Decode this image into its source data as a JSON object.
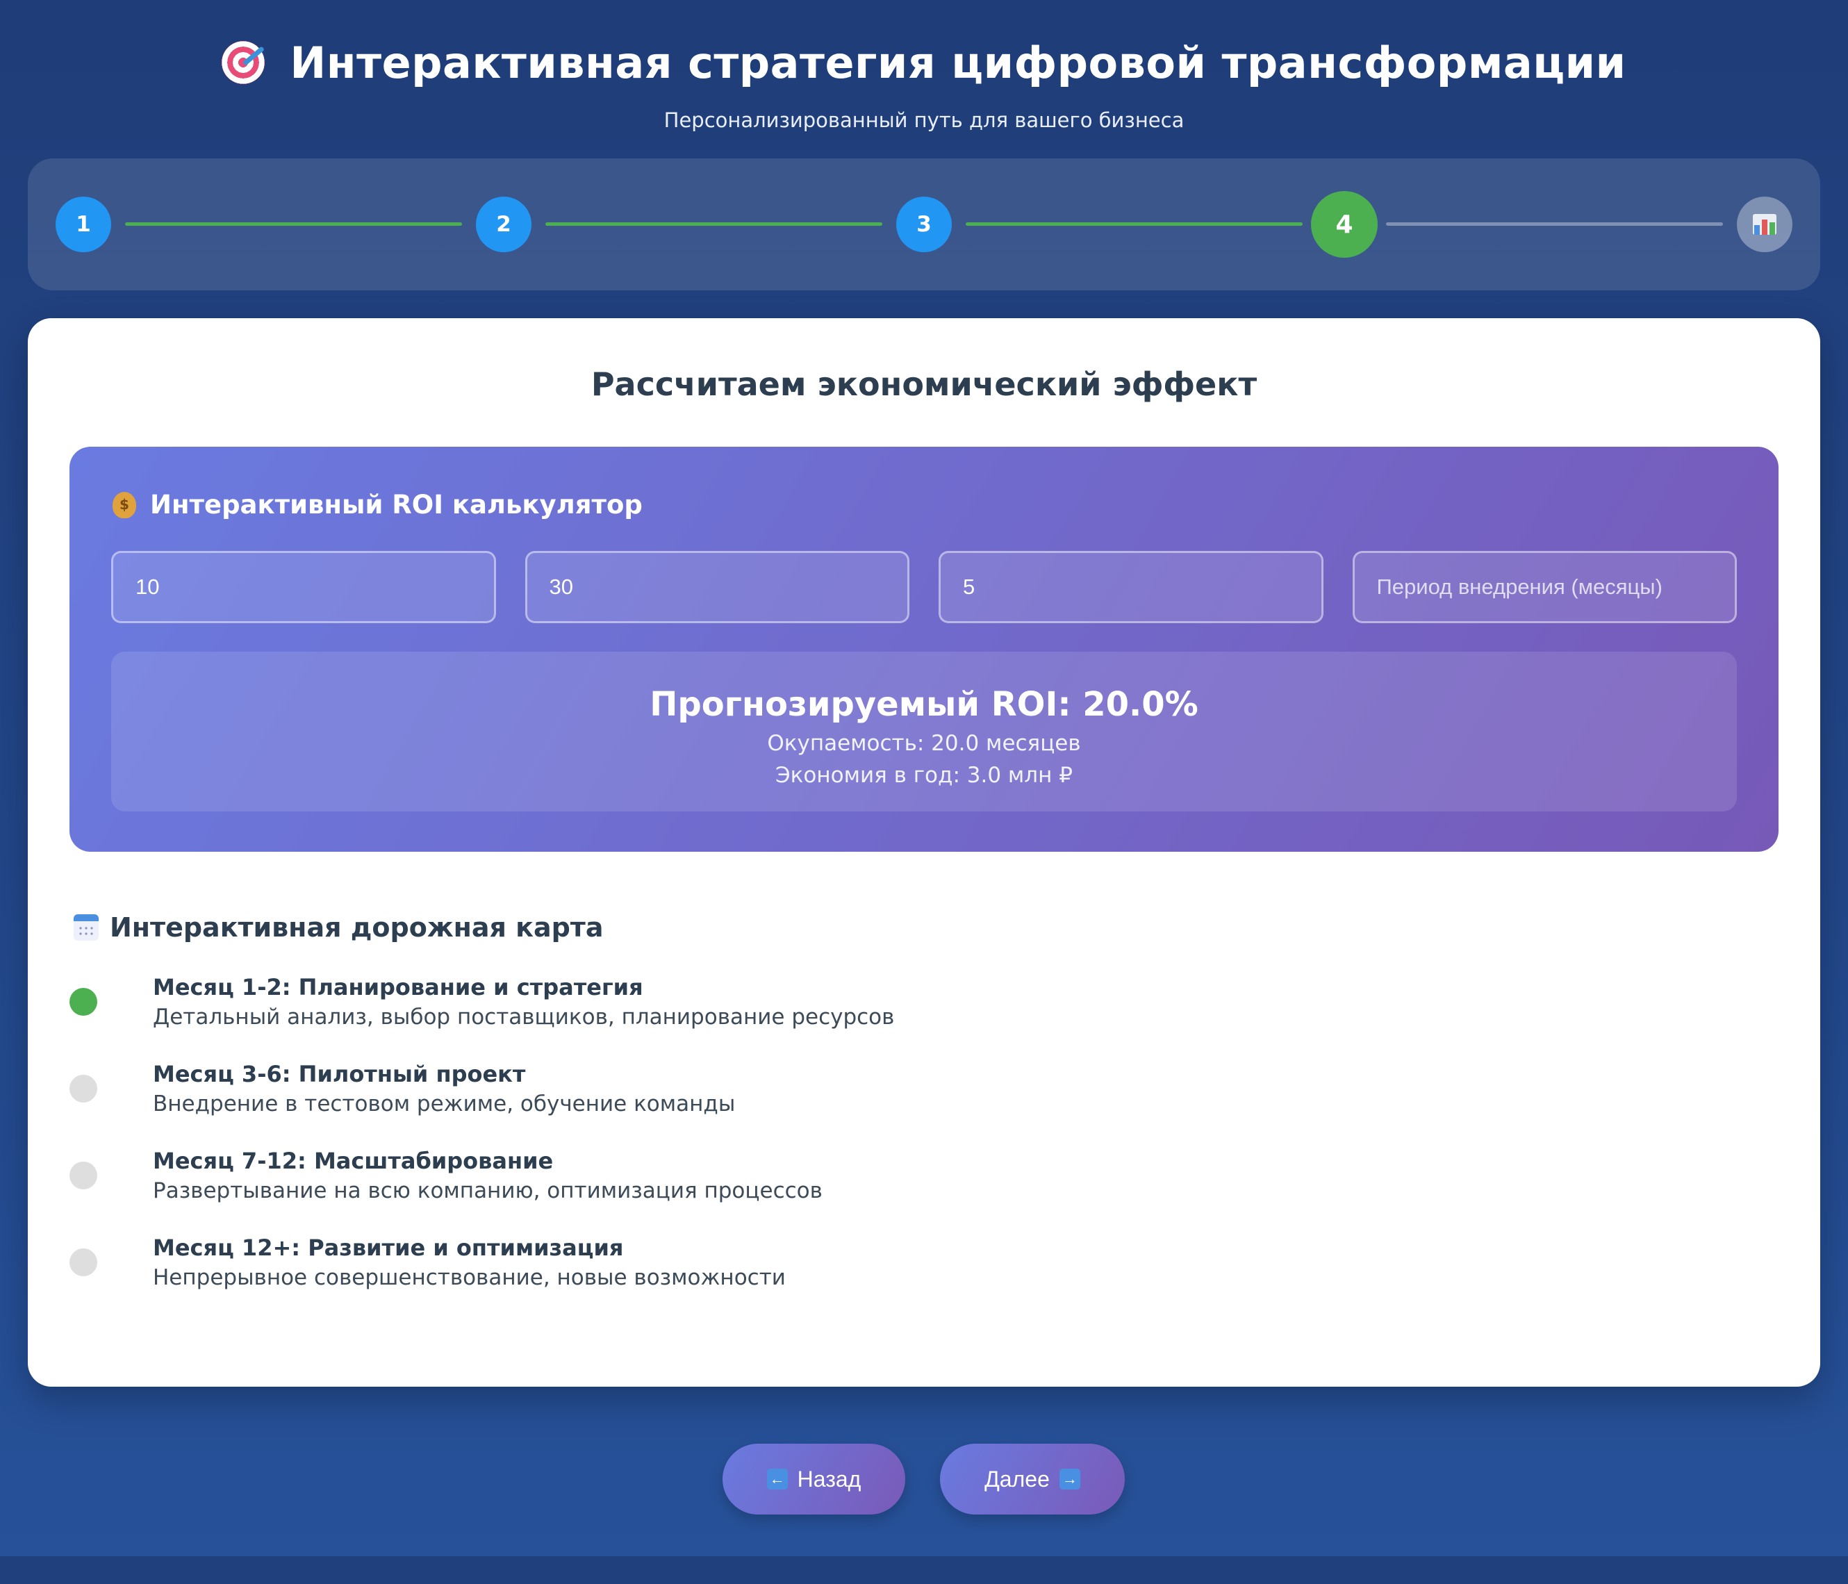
{
  "header": {
    "title": "Интерактивная стратегия цифровой трансформации",
    "subtitle": "Персонализированный путь для вашего бизнеса"
  },
  "steps": [
    {
      "label": "1",
      "state": "done"
    },
    {
      "label": "2",
      "state": "done"
    },
    {
      "label": "3",
      "state": "done"
    },
    {
      "label": "4",
      "state": "active"
    },
    {
      "icon": "bar-chart-icon",
      "state": "pending"
    }
  ],
  "colors": {
    "step_done": "#2196f3",
    "step_active": "#4caf50",
    "accent_gradient_start": "#6a7be0",
    "accent_gradient_end": "#7759b8"
  },
  "section": {
    "title": "Рассчитаем экономический эффект"
  },
  "roi": {
    "title": "Интерактивный ROI калькулятор",
    "inputs": [
      {
        "value": "10",
        "placeholder": ""
      },
      {
        "value": "30",
        "placeholder": ""
      },
      {
        "value": "5",
        "placeholder": ""
      },
      {
        "value": "",
        "placeholder": "Период внедрения (месяцы)"
      }
    ],
    "result_title": "Прогнозируемый ROI: 20.0%",
    "payback": "Окупаемость: 20.0 месяцев",
    "savings": "Экономия в год: 3.0 млн ₽"
  },
  "roadmap": {
    "title": "Интерактивная дорожная карта",
    "items": [
      {
        "heading": "Месяц 1-2: Планирование и стратегия",
        "description": "Детальный анализ, выбор поставщиков, планирование ресурсов",
        "status": "done"
      },
      {
        "heading": "Месяц 3-6: Пилотный проект",
        "description": "Внедрение в тестовом режиме, обучение команды",
        "status": "pending"
      },
      {
        "heading": "Месяц 7-12: Масштабирование",
        "description": "Развертывание на всю компанию, оптимизация процессов",
        "status": "pending"
      },
      {
        "heading": "Месяц 12+: Развитие и оптимизация",
        "description": "Непрерывное совершенствование, новые возможности",
        "status": "pending"
      }
    ]
  },
  "nav": {
    "back_label": "Назад",
    "next_label": "Далее"
  }
}
